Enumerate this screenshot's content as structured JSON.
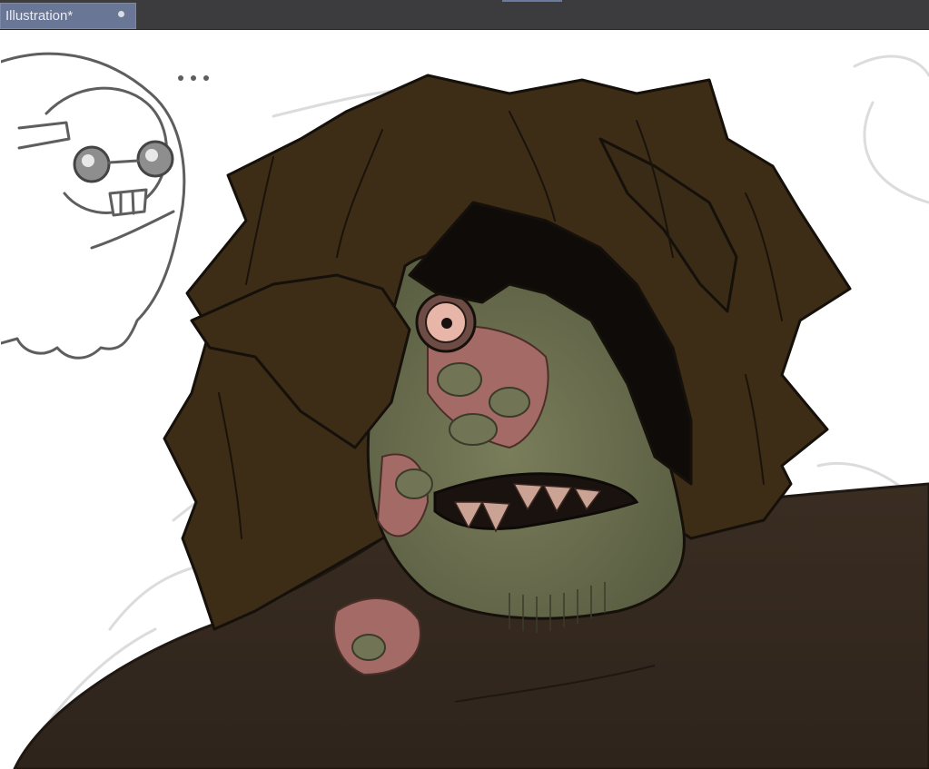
{
  "document": {
    "tab_label": "Illustration*",
    "modified_indicator": "unsaved-dot-icon"
  },
  "colors": {
    "tabbar_bg": "#3c3c3e",
    "tab_active_bg": "#6a7696",
    "canvas_bg": "#ffffff",
    "hair": "#3e2e18",
    "skin": "#6b7050",
    "body": "#35291f"
  },
  "canvas": {
    "content": "digital-illustration"
  }
}
